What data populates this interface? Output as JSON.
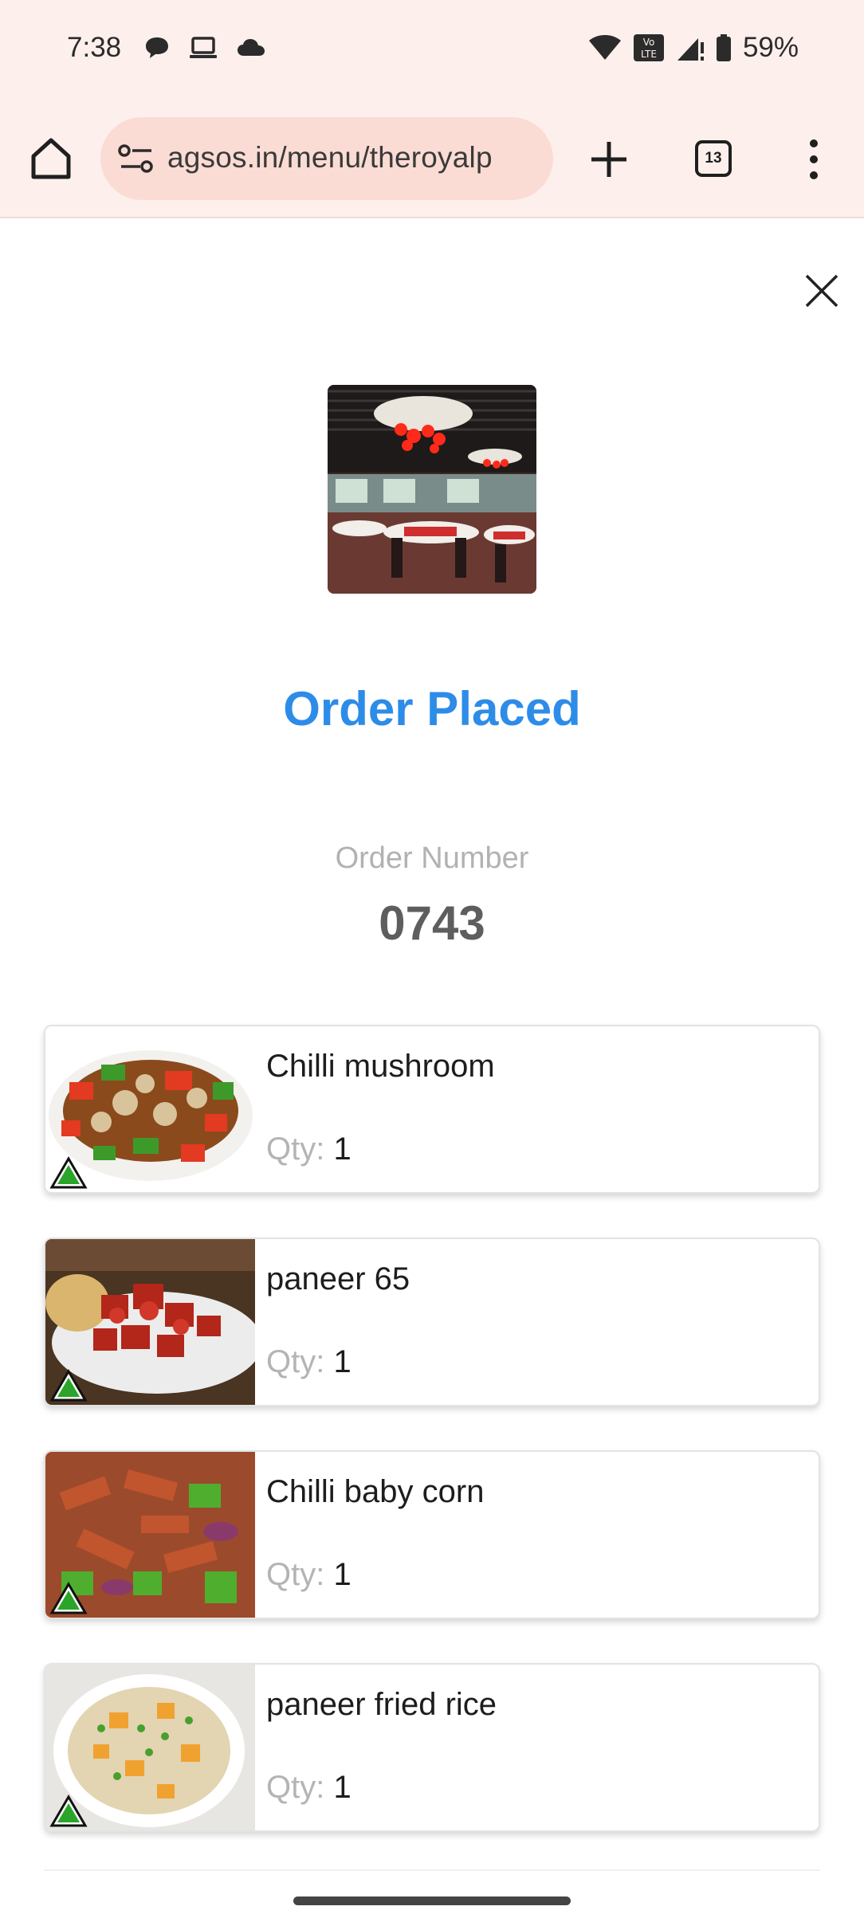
{
  "status_bar": {
    "time": "7:38",
    "battery": "59%",
    "icons": [
      "chat-icon",
      "laptop-icon",
      "cloud-icon",
      "wifi-icon",
      "volte-icon",
      "signal-icon",
      "battery-icon"
    ]
  },
  "browser": {
    "url": "agsos.in/menu/theroyalp",
    "tab_count": "13"
  },
  "page": {
    "title": "Order Placed",
    "order_number_label": "Order Number",
    "order_number": "0743",
    "colors": {
      "title": "#2d8ce8",
      "veg_mark": "#2aa52a"
    }
  },
  "order_items": [
    {
      "name": "Chilli mushroom",
      "qty_label": "Qty:",
      "qty": "1"
    },
    {
      "name": "paneer 65",
      "qty_label": "Qty:",
      "qty": "1"
    },
    {
      "name": "Chilli baby corn",
      "qty_label": "Qty:",
      "qty": "1"
    },
    {
      "name": "paneer fried rice",
      "qty_label": "Qty:",
      "qty": "1"
    }
  ]
}
